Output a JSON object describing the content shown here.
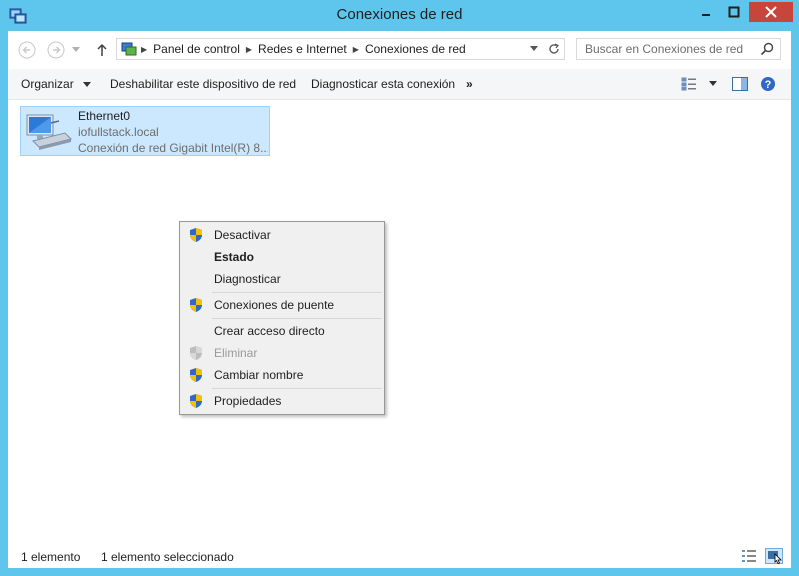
{
  "window": {
    "title": "Conexiones de red"
  },
  "nav": {
    "back": "back",
    "forward": "forward",
    "recent": "recent-locations",
    "up": "up"
  },
  "address": {
    "crumbs": [
      "Panel de control",
      "Redes e Internet",
      "Conexiones de red"
    ]
  },
  "search": {
    "placeholder": "Buscar en Conexiones de red"
  },
  "commands": {
    "organize": "Organizar",
    "disable": "Deshabilitar este dispositivo de red",
    "diagnose": "Diagnosticar esta conexión",
    "more": "»"
  },
  "item": {
    "name": "Ethernet0",
    "domain": "iofullstack.local",
    "adapter": "Conexión de red Gigabit Intel(R) 8..."
  },
  "context_menu": {
    "items": [
      {
        "label": "Desactivar",
        "shield": true,
        "bold": false,
        "disabled": false
      },
      {
        "label": "Estado",
        "shield": false,
        "bold": true,
        "disabled": false
      },
      {
        "label": "Diagnosticar",
        "shield": false,
        "bold": false,
        "disabled": false
      },
      {
        "label": "Conexiones de puente",
        "shield": true,
        "bold": false,
        "disabled": false
      },
      {
        "label": "Crear acceso directo",
        "shield": false,
        "bold": false,
        "disabled": false
      },
      {
        "label": "Eliminar",
        "shield": true,
        "bold": false,
        "disabled": true
      },
      {
        "label": "Cambiar nombre",
        "shield": true,
        "bold": false,
        "disabled": false
      },
      {
        "label": "Propiedades",
        "shield": true,
        "bold": false,
        "disabled": false
      }
    ]
  },
  "status": {
    "count": "1 elemento",
    "selected": "1 elemento seleccionado"
  },
  "colors": {
    "titlebar": "#5ec6ec",
    "close": "#c7453a",
    "selection": "#cce8ff"
  }
}
